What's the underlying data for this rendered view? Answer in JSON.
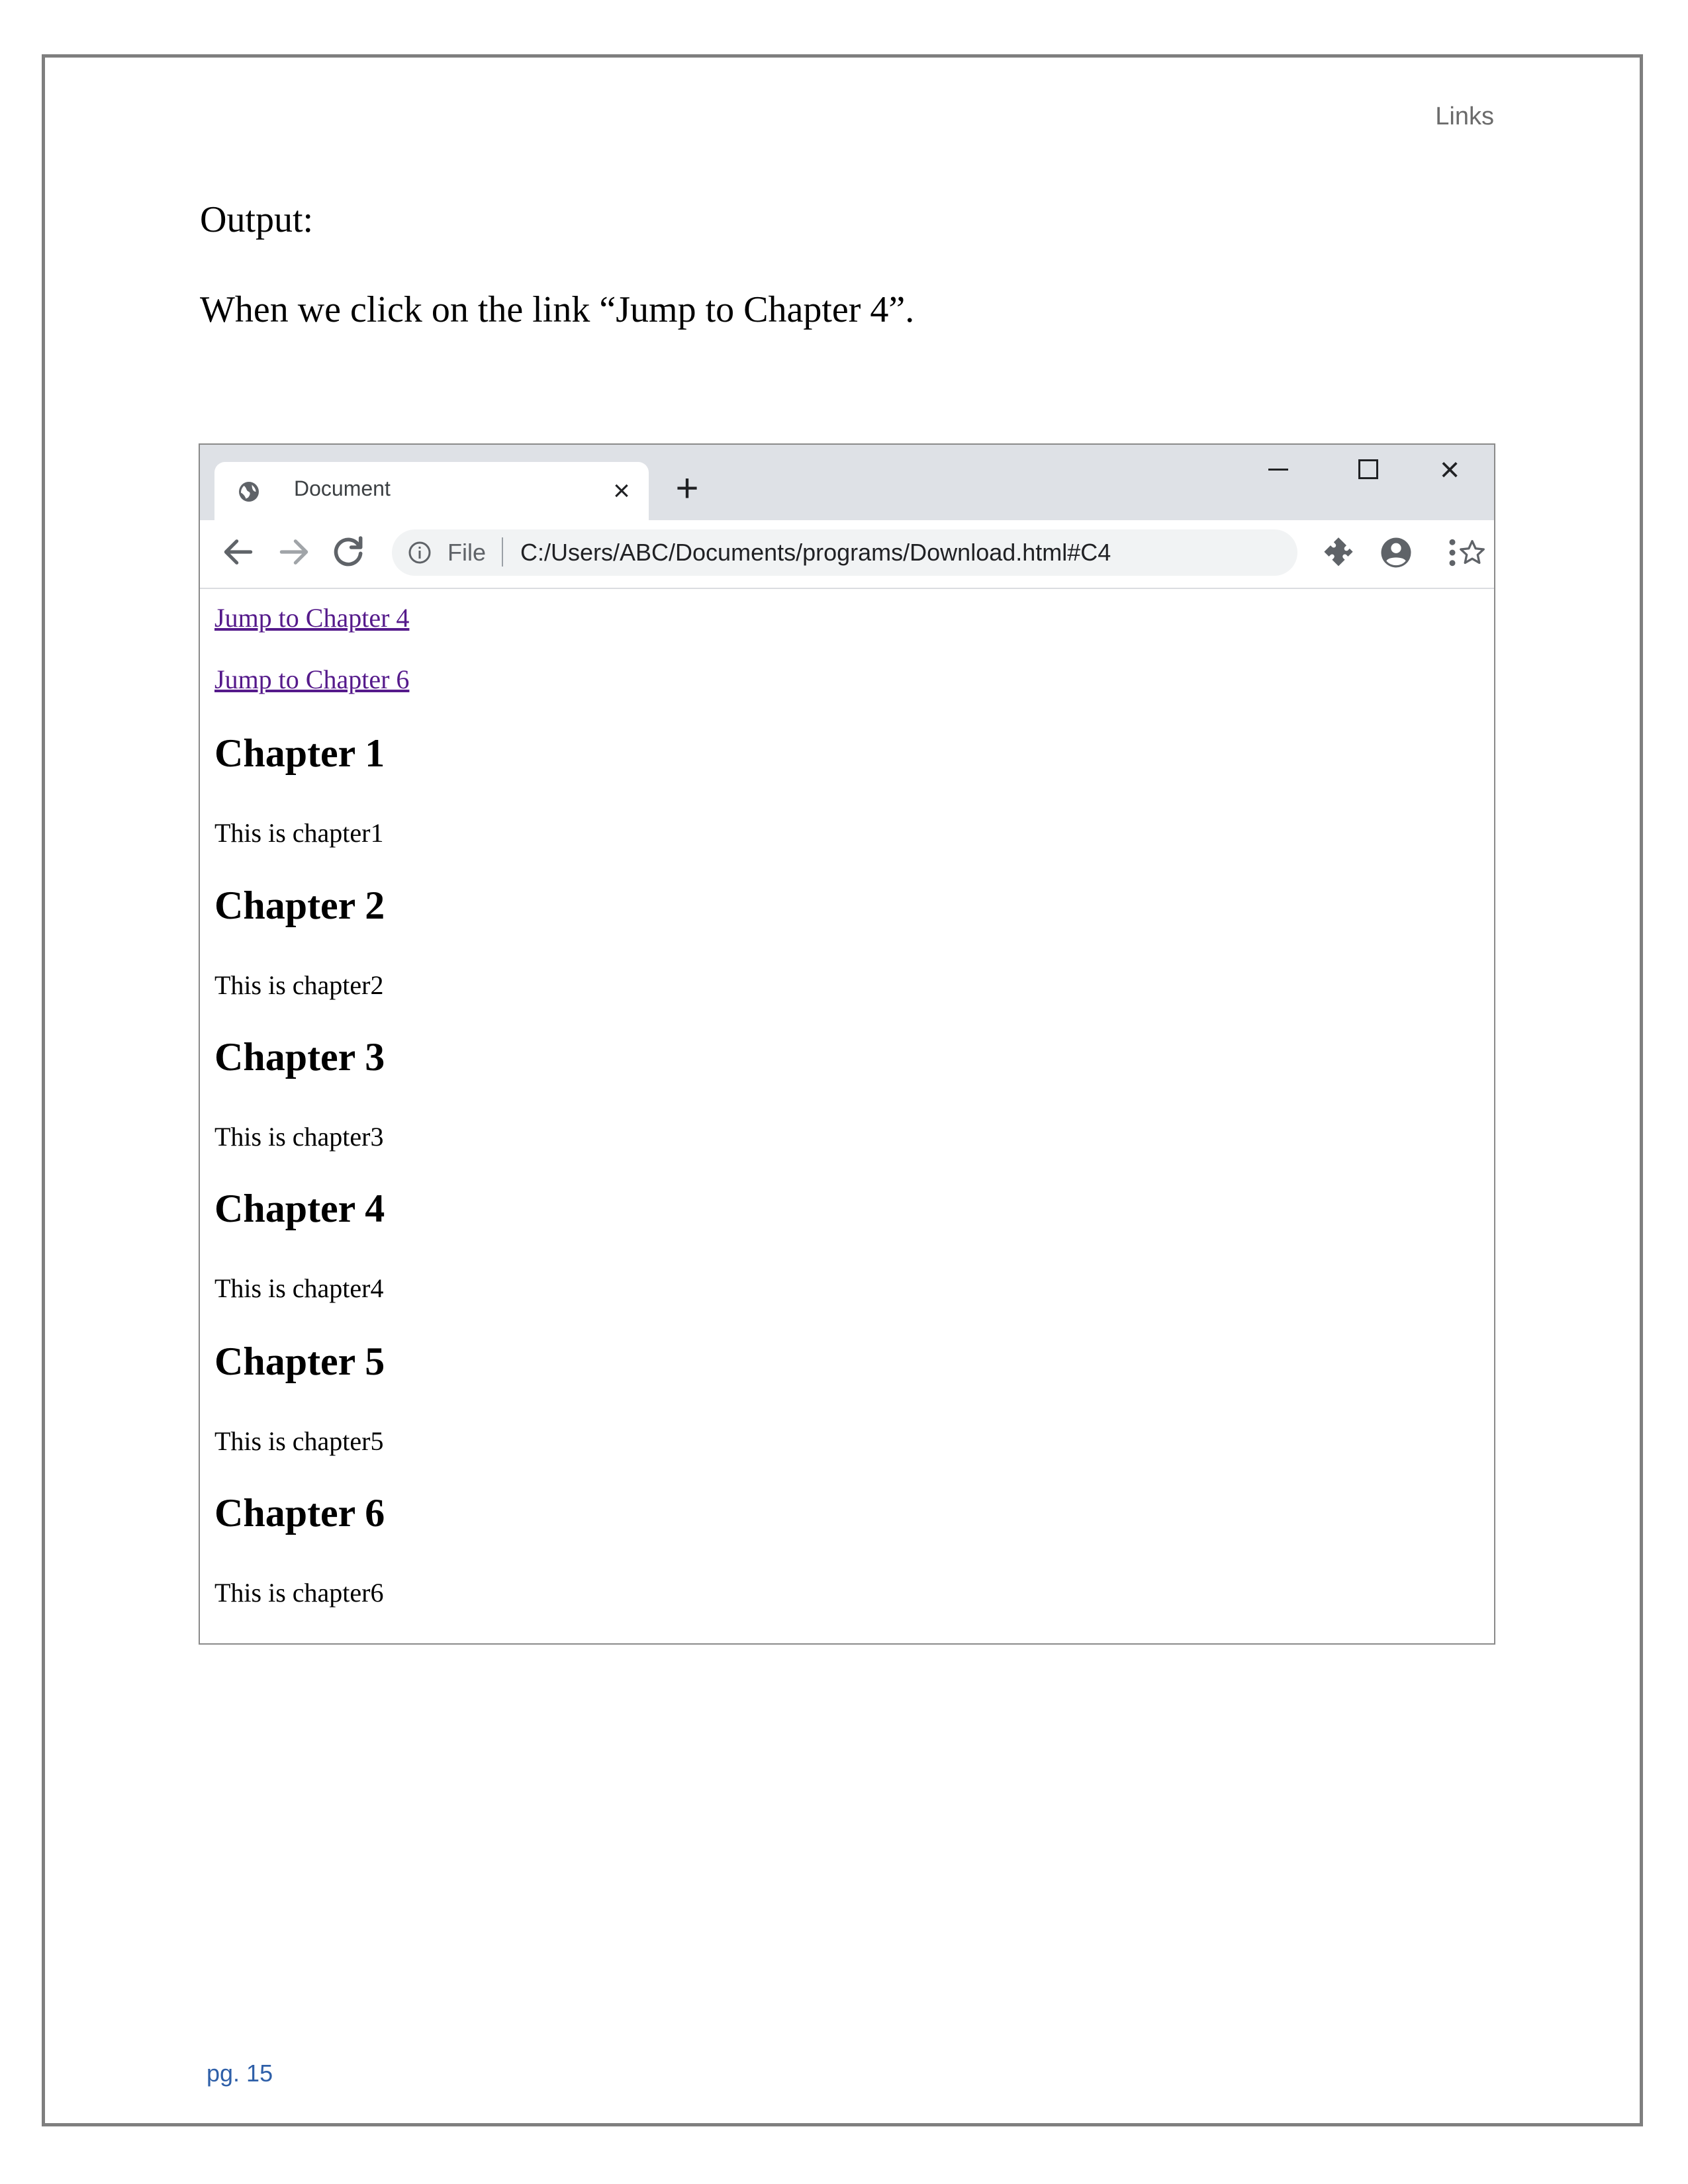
{
  "header": {
    "running_title": "Links"
  },
  "doc": {
    "output_label": "Output:",
    "caption": "When we click on the link “Jump to Chapter 4”."
  },
  "browser": {
    "tab_title": "Document",
    "tab_close": "×",
    "new_tab": "+",
    "win_close": "×",
    "file_label": "File",
    "url": "C:/Users/ABC/Documents/programs/Download.html#C4",
    "icons": [
      "globe-icon",
      "back-arrow-icon",
      "forward-arrow-icon",
      "reload-icon",
      "info-icon",
      "star-icon",
      "extensions-icon",
      "profile-icon",
      "menu-icon",
      "minimize-icon",
      "maximize-icon",
      "close-icon"
    ]
  },
  "page": {
    "links": [
      "Jump to Chapter 4",
      "Jump to Chapter 6"
    ],
    "chapters": [
      {
        "title": "Chapter 1",
        "text": "This is chapter1"
      },
      {
        "title": "Chapter 2",
        "text": "This is chapter2"
      },
      {
        "title": "Chapter 3",
        "text": "This is chapter3"
      },
      {
        "title": "Chapter 4",
        "text": "This is chapter4"
      },
      {
        "title": "Chapter 5",
        "text": "This is chapter5"
      },
      {
        "title": "Chapter 6",
        "text": "This is chapter6"
      }
    ]
  },
  "footer": {
    "page_number": "pg. 15"
  },
  "colors": {
    "link": "#551a8b",
    "page_number": "#2e5fa8",
    "tab_strip": "#dee1e6",
    "omnibox": "#f1f3f4"
  }
}
